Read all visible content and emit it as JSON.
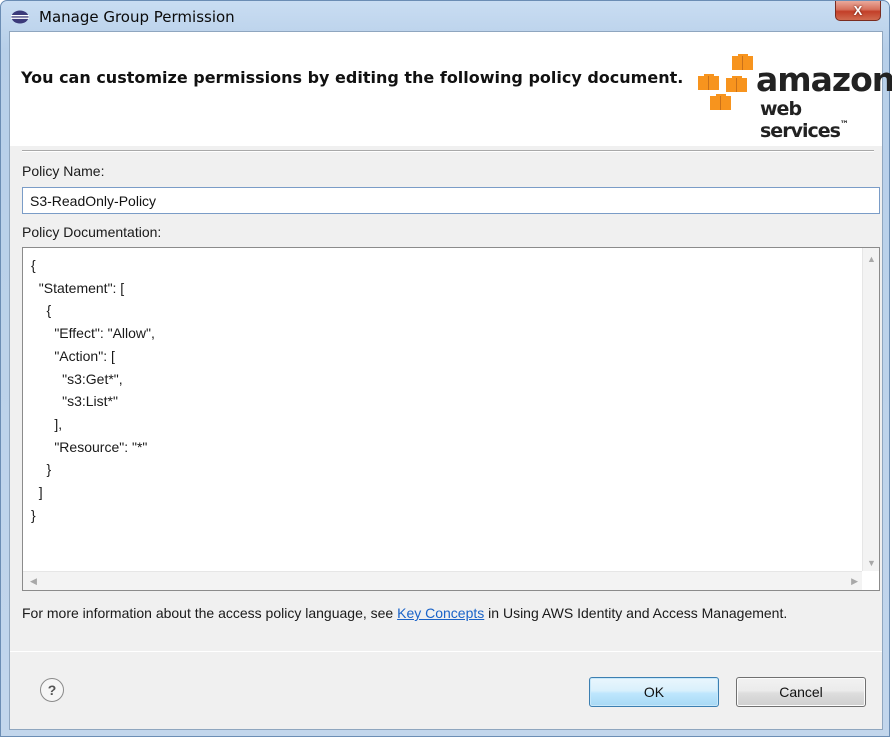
{
  "window": {
    "title": "Manage Group Permission",
    "close_glyph": "X"
  },
  "banner": {
    "text": "You can customize permissions by editing the following policy document.",
    "logo": {
      "word1": "amazon",
      "word2": "web services",
      "tm": "™"
    }
  },
  "form": {
    "policy_name_label": "Policy Name:",
    "policy_name_value": "S3-ReadOnly-Policy",
    "policy_doc_label": "Policy Documentation:",
    "policy_doc_value": "{\n  \"Statement\": [\n    {\n      \"Effect\": \"Allow\",\n      \"Action\": [\n        \"s3:Get*\",\n        \"s3:List*\"\n      ],\n      \"Resource\": \"*\"\n    }\n  ]\n}"
  },
  "info": {
    "prefix": "For more information about the access policy language, see ",
    "link": "Key Concepts",
    "suffix": " in Using AWS Identity and Access Management."
  },
  "buttons": {
    "help": "?",
    "ok": "OK",
    "cancel": "Cancel"
  },
  "colors": {
    "aws_orange": "#f7941e",
    "link_blue": "#1a63c8"
  }
}
